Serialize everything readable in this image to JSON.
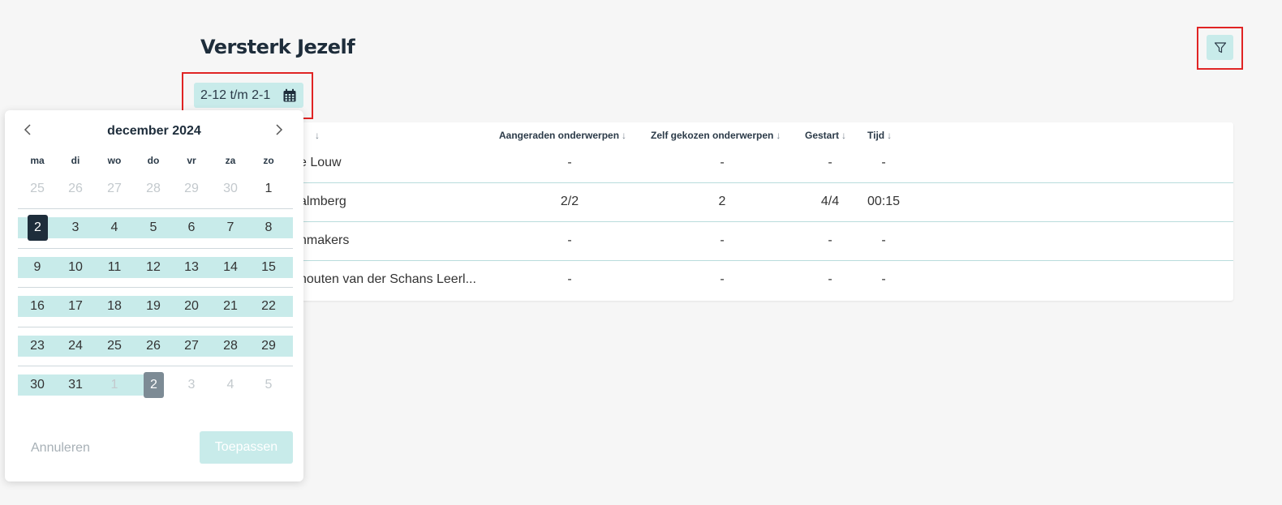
{
  "page": {
    "title": "Versterk Jezelf",
    "filter_icon": "filter-icon"
  },
  "date_range": {
    "label": "2-12 t/m 2-1",
    "icon": "calendar-icon"
  },
  "table": {
    "columns": [
      {
        "label": "",
        "sort_icon": "↓"
      },
      {
        "label": "Aangeraden onderwerpen",
        "sort_icon": "↓"
      },
      {
        "label": "Zelf gekozen onderwerpen",
        "sort_icon": "↓"
      },
      {
        "label": "Gestart",
        "sort_icon": "↓"
      },
      {
        "label": "Tijd",
        "sort_icon": "↓"
      }
    ],
    "rows": [
      {
        "name": "e Louw",
        "recommended": "-",
        "chosen": "-",
        "started": "-",
        "time": "-"
      },
      {
        "name": "almberg",
        "recommended": "2/2",
        "chosen": "2",
        "started": "4/4",
        "time": "00:15"
      },
      {
        "name": "nmakers",
        "recommended": "-",
        "chosen": "-",
        "started": "-",
        "time": "-"
      },
      {
        "name": "houten van der Schans Leerl...",
        "recommended": "-",
        "chosen": "-",
        "started": "-",
        "time": "-"
      }
    ]
  },
  "calendar": {
    "month_label": "december 2024",
    "prev_icon": "chevron-left-icon",
    "next_icon": "chevron-right-icon",
    "weekdays": [
      "ma",
      "di",
      "wo",
      "do",
      "vr",
      "za",
      "zo"
    ],
    "weeks": [
      [
        "25",
        "26",
        "27",
        "28",
        "29",
        "30",
        "1"
      ],
      [
        "2",
        "3",
        "4",
        "5",
        "6",
        "7",
        "8"
      ],
      [
        "9",
        "10",
        "11",
        "12",
        "13",
        "14",
        "15"
      ],
      [
        "16",
        "17",
        "18",
        "19",
        "20",
        "21",
        "22"
      ],
      [
        "23",
        "24",
        "25",
        "26",
        "27",
        "28",
        "29"
      ],
      [
        "30",
        "31",
        "1",
        "2",
        "3",
        "4",
        "5"
      ]
    ],
    "cancel_label": "Annuleren",
    "apply_label": "Toepassen"
  },
  "colors": {
    "accent_light": "#c8ebea",
    "dark": "#1e2d3b",
    "highlight_border": "#e02424"
  }
}
